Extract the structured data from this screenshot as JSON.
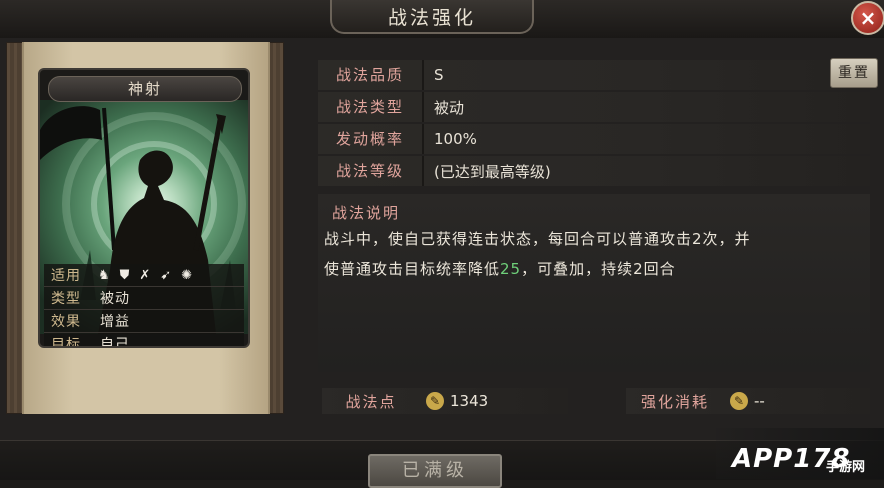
{
  "window": {
    "title": "战法强化",
    "close_label": "×"
  },
  "card": {
    "name": "神射",
    "rows": [
      {
        "key": "适用",
        "value": ""
      },
      {
        "key": "类型",
        "value": "被动"
      },
      {
        "key": "效果",
        "value": "增益"
      },
      {
        "key": "目标",
        "value": "自己"
      }
    ],
    "arms_icons": [
      "cavalry-icon",
      "shield-icon",
      "bow-icon",
      "spear-icon",
      "chariot-icon"
    ]
  },
  "info": {
    "quality_label": "战法品质",
    "quality_value": "S",
    "type_label": "战法类型",
    "type_value": "被动",
    "rate_label": "发动概率",
    "rate_value": "100%",
    "level_label": "战法等级",
    "level_value": "(已达到最高等级)",
    "reset_label": "重置"
  },
  "description": {
    "title": "战法说明",
    "line1": "战斗中，使自己获得连击状态，每回合可以普通攻击2次，并",
    "line2_a": "使普通攻击目标统率降低",
    "line2_num": "25",
    "line2_b": "，可叠加，持续2回合"
  },
  "stats": {
    "points_label": "战法点",
    "points_value": "1343",
    "cost_label": "强化消耗",
    "cost_value": "--"
  },
  "action": {
    "button_label": "已满级"
  },
  "watermark": {
    "logo": "APP178",
    "sub": "手游网"
  }
}
